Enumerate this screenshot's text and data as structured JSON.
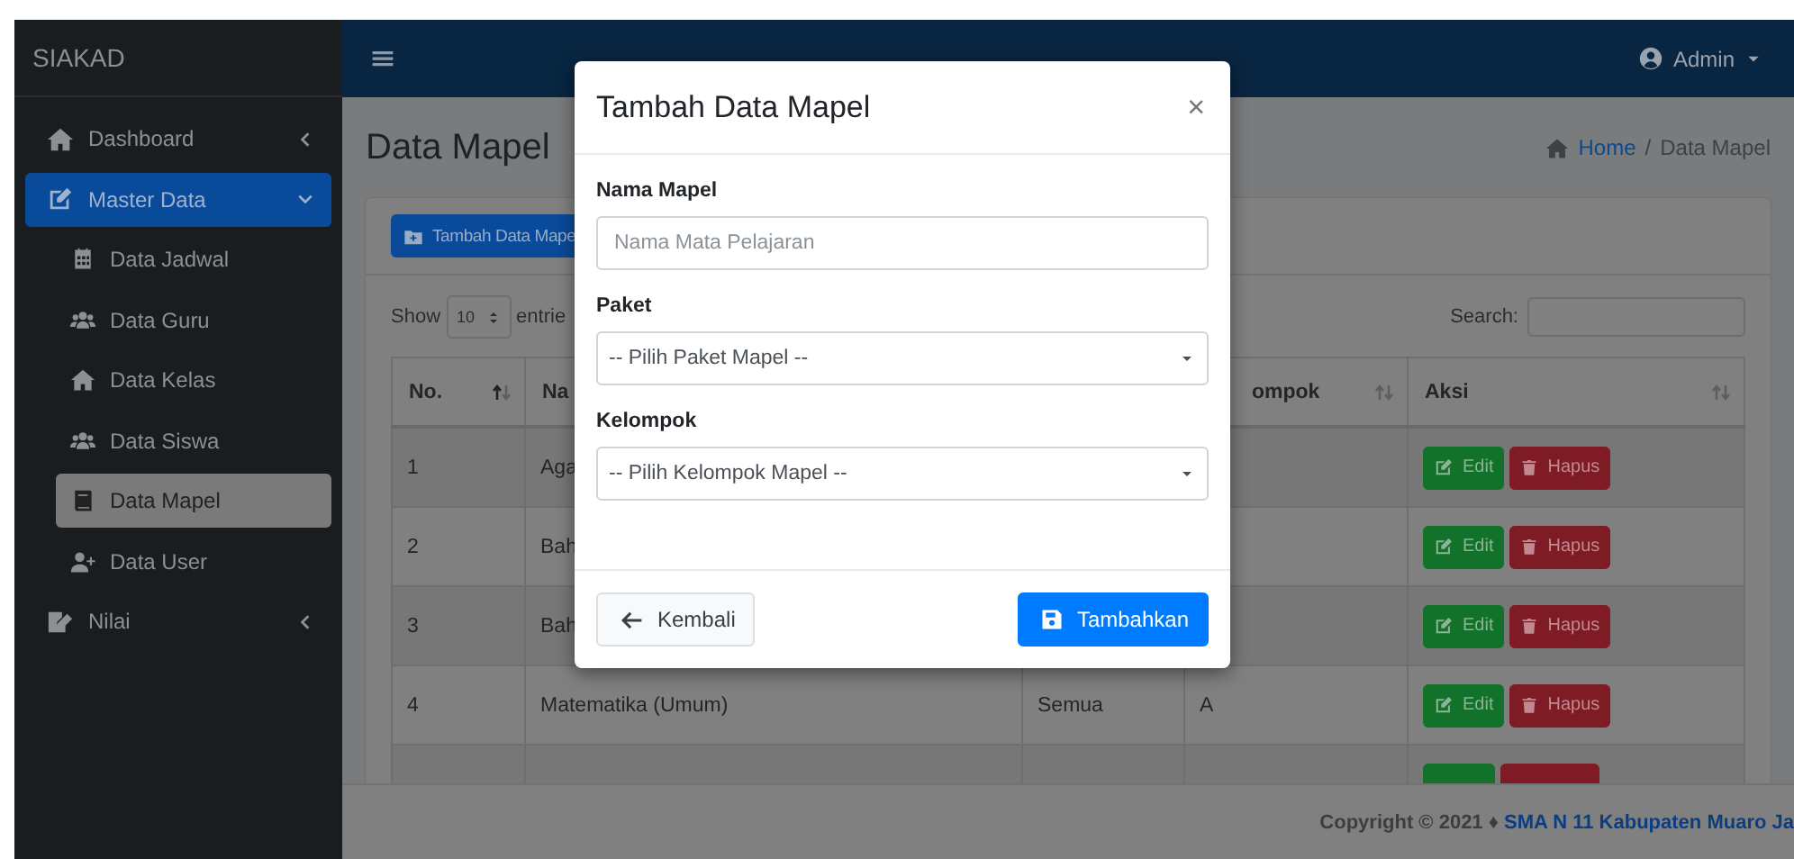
{
  "sidebar": {
    "brand": "SIAKAD",
    "items": [
      {
        "label": "Dashboard",
        "selected": false,
        "expanded": false
      },
      {
        "label": "Master Data",
        "selected": true,
        "expanded": true,
        "children": [
          {
            "label": "Data Jadwal",
            "selected": false
          },
          {
            "label": "Data Guru",
            "selected": false
          },
          {
            "label": "Data Kelas",
            "selected": false
          },
          {
            "label": "Data Siswa",
            "selected": false
          },
          {
            "label": "Data Mapel",
            "selected": true
          },
          {
            "label": "Data User",
            "selected": false
          }
        ]
      },
      {
        "label": "Nilai",
        "selected": false,
        "expanded": false
      }
    ]
  },
  "topbar": {
    "user": "Admin"
  },
  "content": {
    "title": "Data Mapel",
    "breadcrumb": [
      {
        "label": "Home",
        "link": true
      },
      {
        "label": "Data Mapel",
        "link": false
      }
    ],
    "separator": "/",
    "card": {
      "add_button": "Tambah Data Mape",
      "show_label": "Show",
      "page_size": "10",
      "entries_label": "entrie",
      "search_label": "Search:",
      "columns": [
        {
          "label": "No.",
          "sorted": true
        },
        {
          "label": "Na"
        },
        {},
        {
          "label": "ompok",
          "sorted": false
        },
        {
          "label": "Aksi",
          "sorted": false
        }
      ],
      "rows": [
        {
          "no": "1",
          "nama": "Aga",
          "actions": [
            {
              "kind": "edit",
              "label": "Edit"
            },
            {
              "kind": "delete",
              "label": "Hapus"
            }
          ]
        },
        {
          "no": "2",
          "nama": "Bah",
          "actions": [
            {
              "kind": "edit",
              "label": "Edit"
            },
            {
              "kind": "delete",
              "label": "Hapus"
            }
          ]
        },
        {
          "no": "3",
          "nama": "Bah",
          "actions": [
            {
              "kind": "edit",
              "label": "Edit"
            },
            {
              "kind": "delete",
              "label": "Hapus"
            }
          ]
        },
        {
          "no": "4",
          "nama": "Matematika (Umum)",
          "paket": "Semua",
          "kelompok": "A",
          "actions": [
            {
              "kind": "edit",
              "label": "Edit"
            },
            {
              "kind": "delete",
              "label": "Hapus"
            }
          ]
        },
        {
          "actions": [
            {
              "kind": "edit"
            },
            {
              "kind": "delete"
            }
          ]
        }
      ]
    }
  },
  "footer": {
    "text": "Copyright © 2021 ♦",
    "link": "SMA N 11 Kabupaten Muaro Ja"
  },
  "modal": {
    "title": "Tambah Data Mapel",
    "close": "×",
    "fields": [
      {
        "kind": "text",
        "label": "Nama Mapel",
        "placeholder": "Nama Mata Pelajaran"
      },
      {
        "kind": "select",
        "label": "Paket",
        "value": "-- Pilih Paket Mapel --"
      },
      {
        "kind": "select",
        "label": "Kelompok",
        "value": "-- Pilih Kelompok Mapel --"
      }
    ],
    "buttons": [
      {
        "kind": "secondary",
        "label": "Kembali"
      },
      {
        "kind": "primary",
        "label": "Tambahkan"
      }
    ]
  }
}
